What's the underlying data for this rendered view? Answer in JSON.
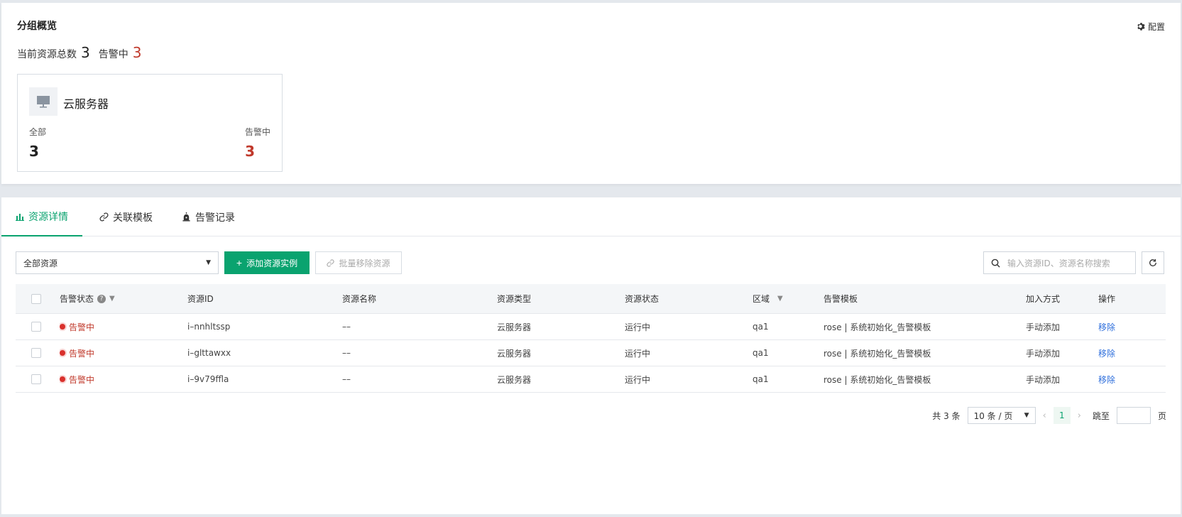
{
  "overview": {
    "title": "分组概览",
    "config_label": "配置",
    "total_label": "当前资源总数",
    "total_value": "3",
    "alarm_label": "告警中",
    "alarm_value": "3",
    "card": {
      "title": "云服务器",
      "all_label": "全部",
      "all_value": "3",
      "alarm_label": "告警中",
      "alarm_value": "3"
    }
  },
  "tabs": [
    {
      "label": "资源详情",
      "icon": "bar-chart-icon",
      "active": true
    },
    {
      "label": "关联模板",
      "icon": "link-icon"
    },
    {
      "label": "告警记录",
      "icon": "alarm-light-icon"
    }
  ],
  "toolbar": {
    "filter_value": "全部资源",
    "add_label": "添加资源实例",
    "batch_remove_label": "批量移除资源",
    "search_placeholder": "输入资源ID、资源名称搜索"
  },
  "table": {
    "headers": [
      "告警状态",
      "资源ID",
      "资源名称",
      "资源类型",
      "资源状态",
      "区域",
      "告警模板",
      "加入方式",
      "操作"
    ],
    "rows": [
      {
        "status": "告警中",
        "id": "i–nnhltssp",
        "name": "––",
        "type": "云服务器",
        "state": "运行中",
        "region": "qa1",
        "template": "rose | 系统初始化_告警模板",
        "join": "手动添加",
        "action": "移除"
      },
      {
        "status": "告警中",
        "id": "i–glttawxx",
        "name": "––",
        "type": "云服务器",
        "state": "运行中",
        "region": "qa1",
        "template": "rose | 系统初始化_告警模板",
        "join": "手动添加",
        "action": "移除"
      },
      {
        "status": "告警中",
        "id": "i–9v79ffla",
        "name": "––",
        "type": "云服务器",
        "state": "运行中",
        "region": "qa1",
        "template": "rose | 系统初始化_告警模板",
        "join": "手动添加",
        "action": "移除"
      }
    ]
  },
  "pagination": {
    "total_label": "共 3 条",
    "page_size": "10 条 / 页",
    "current_page": "1",
    "jump_label": "跳至",
    "page_suffix": "页"
  },
  "colors": {
    "accent": "#0aa36f",
    "alarm": "#c0392b",
    "link": "#2f6fdc"
  }
}
